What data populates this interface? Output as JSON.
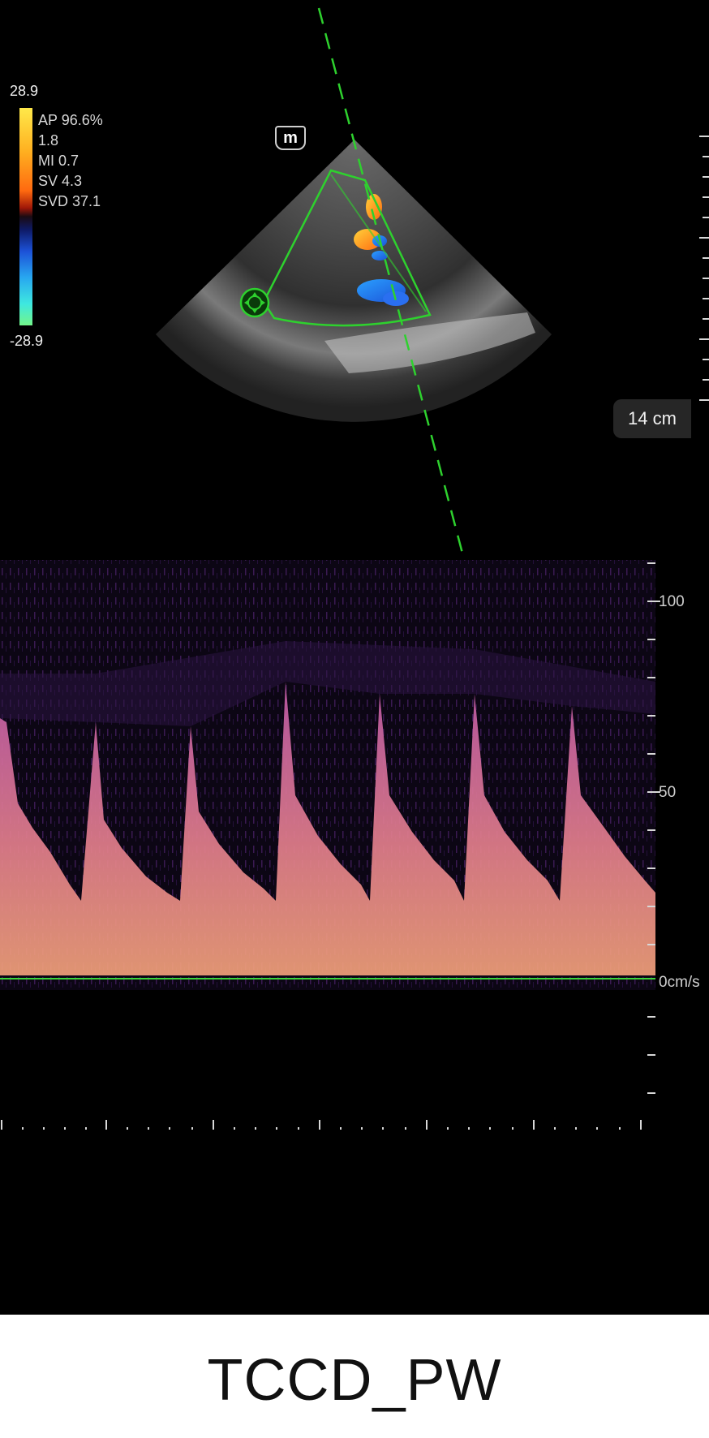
{
  "color_scale": {
    "top_label": "28.9",
    "bottom_label": "-28.9"
  },
  "params": [
    {
      "label": "AP 96.6%"
    },
    {
      "label": "1.8"
    },
    {
      "label": "MI 0.7"
    },
    {
      "label": "SV 4.3"
    },
    {
      "label": "SVD 37.1"
    }
  ],
  "mode_badge": "m",
  "depth": "14 cm",
  "velocity_axis": {
    "labels": [
      "100",
      "50",
      "0cm/s"
    ],
    "unit": "cm/s"
  },
  "footer": {
    "title": "TCCD_PW"
  },
  "colors": {
    "guide": "#2ed12e",
    "spectral": "#e0808c",
    "baseline": "#3bd43b"
  },
  "icons": {
    "gate_control": "move-crosshair-icon"
  }
}
